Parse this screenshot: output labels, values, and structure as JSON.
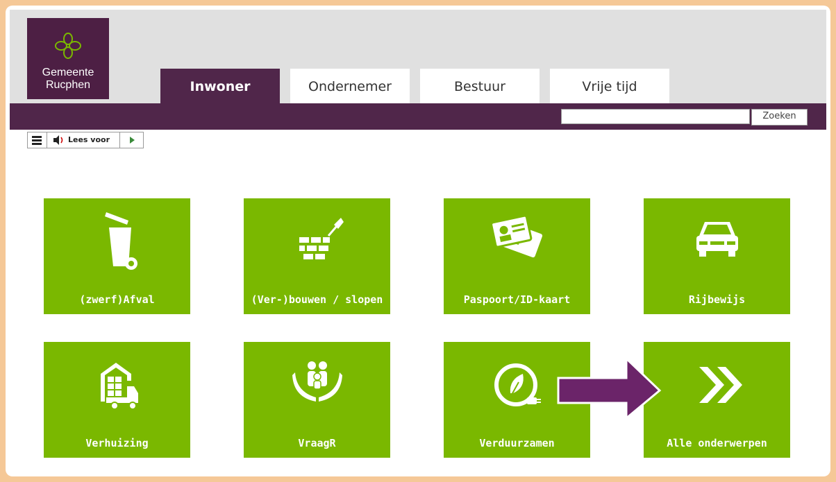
{
  "logo": {
    "line1": "Gemeente",
    "line2": "Rucphen"
  },
  "tabs": [
    {
      "label": "Inwoner",
      "active": true
    },
    {
      "label": "Ondernemer",
      "active": false
    },
    {
      "label": "Bestuur",
      "active": false
    },
    {
      "label": "Vrije tijd",
      "active": false
    }
  ],
  "search": {
    "value": "",
    "button_label": "Zoeken"
  },
  "readspeaker": {
    "listen_label": "Lees voor"
  },
  "tiles": [
    {
      "label": "(zwerf)Afval",
      "icon": "trash-bin-icon"
    },
    {
      "label": "(Ver-)bouwen / slopen",
      "icon": "bricks-trowel-icon"
    },
    {
      "label": "Paspoort/ID-kaart",
      "icon": "id-card-icon"
    },
    {
      "label": "Rijbewijs",
      "icon": "car-icon"
    },
    {
      "label": "Verhuizing",
      "icon": "moving-truck-icon"
    },
    {
      "label": "VraagR",
      "icon": "family-hands-icon"
    },
    {
      "label": "Verduurzamen",
      "icon": "eco-plug-icon"
    },
    {
      "label": "Alle onderwerpen",
      "icon": "double-chevron-icon"
    }
  ],
  "colors": {
    "brand": "#50264a",
    "tile": "#7ab800",
    "frame": "#f5c897",
    "annotation_arrow": "#6b2469"
  }
}
